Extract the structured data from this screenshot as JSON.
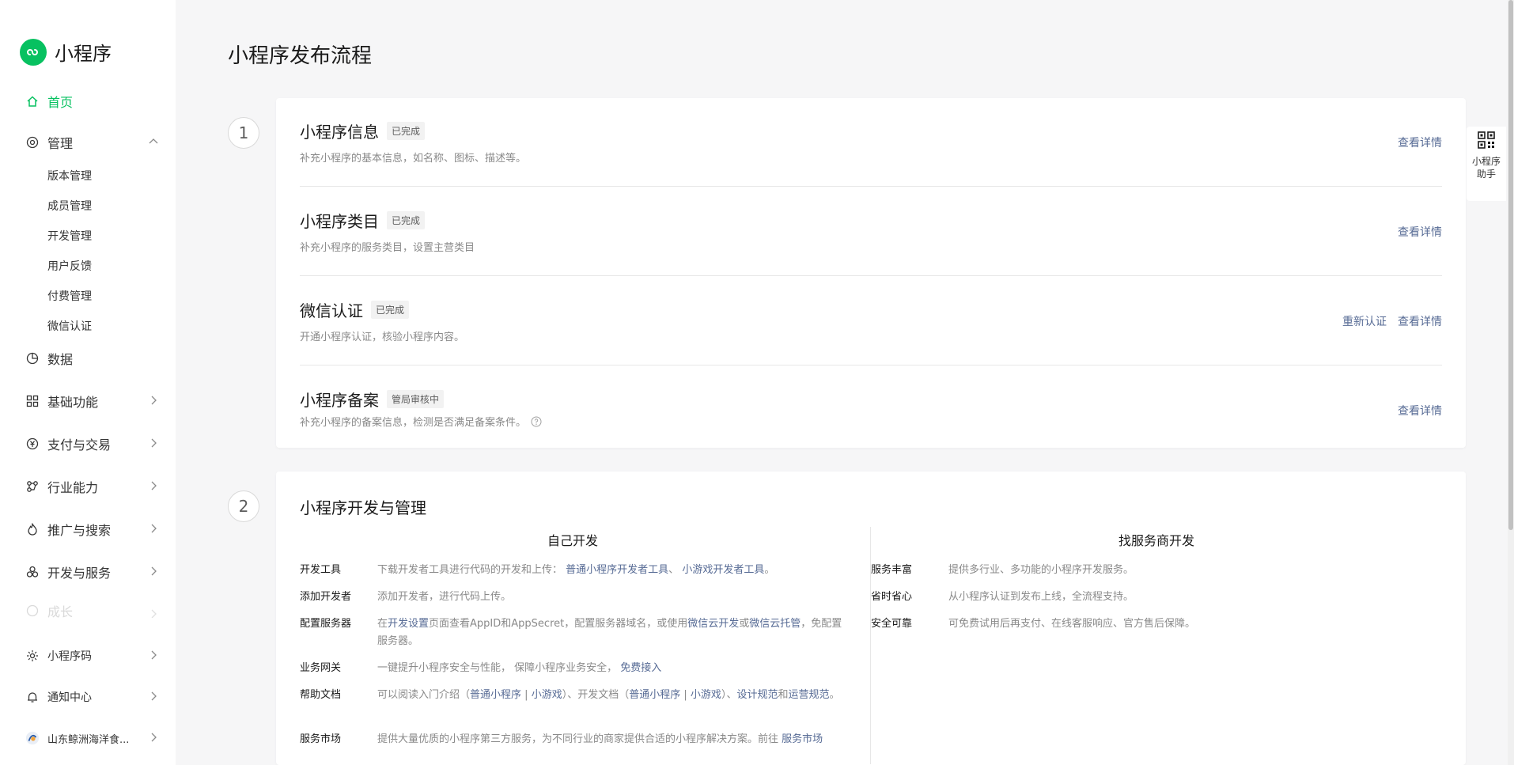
{
  "brand": {
    "name": "小程序"
  },
  "nav": {
    "home": "首页",
    "manage": "管理",
    "manage_sub": [
      "版本管理",
      "成员管理",
      "开发管理",
      "用户反馈",
      "付费管理",
      "微信认证"
    ],
    "data": "数据",
    "basic": "基础功能",
    "pay": "支付与交易",
    "industry": "行业能力",
    "promote": "推广与搜索",
    "devservice": "开发与服务",
    "growth": "成长",
    "qrcode": "小程序码",
    "notice": "通知中心",
    "account": "山东鲸洲海洋食..."
  },
  "page_title": "小程序发布流程",
  "steps": [
    "1",
    "2"
  ],
  "step1_rows": [
    {
      "title": "小程序信息",
      "badge": "已完成",
      "desc": "补充小程序的基本信息，如名称、图标、描述等。",
      "actions": [
        "查看详情"
      ]
    },
    {
      "title": "小程序类目",
      "badge": "已完成",
      "desc": "补充小程序的服务类目，设置主营类目",
      "actions": [
        "查看详情"
      ]
    },
    {
      "title": "微信认证",
      "badge": "已完成",
      "desc": "开通小程序认证，核验小程序内容。",
      "actions": [
        "重新认证",
        "查看详情"
      ]
    },
    {
      "title": "小程序备案",
      "badge": "管局审核中",
      "desc": "补充小程序的备案信息，检测是否满足备案条件。",
      "actions": [
        "查看详情"
      ]
    }
  ],
  "step2": {
    "title": "小程序开发与管理",
    "left_head": "自己开发",
    "right_head": "找服务商开发",
    "dev_tools": {
      "k": "开发工具",
      "pre": "下载开发者工具进行代码的开发和上传：",
      "l1": "普通小程序开发者工具",
      "sep": "、",
      "l2": "小游戏开发者工具",
      "end": "。"
    },
    "add_dev": {
      "k": "添加开发者",
      "v": "添加开发者，进行代码上传。"
    },
    "server": {
      "k": "配置服务器",
      "p1": "在",
      "l1": "开发设置",
      "p2": "页面查看AppID和AppSecret，配置服务器域名，或使用",
      "l2": "微信云开发",
      "p3": "或",
      "l3": "微信云托管",
      "p4": "，免配置服务器。"
    },
    "gateway": {
      "k": "业务网关",
      "v": "一键提升小程序安全与性能， 保障小程序业务安全，",
      "l": "免费接入"
    },
    "docs": {
      "k": "帮助文档",
      "p1": "可以阅读入门介绍（",
      "l1": "普通小程序",
      "bar1": "|",
      "l2": "小游戏",
      "p2": "）、开发文档（",
      "l3": "普通小程序",
      "bar2": "|",
      "l4": "小游戏",
      "p3": "）、",
      "l5": "设计规范",
      "p4": "和",
      "l6": "运营规范",
      "p5": "。"
    },
    "market": {
      "k": "服务市场",
      "v": "提供大量优质的小程序第三方服务，为不同行业的商家提供合适的小程序解决方案。前往",
      "l": "服务市场"
    },
    "right_rows": [
      {
        "k": "服务丰富",
        "v": "提供多行业、多功能的小程序开发服务。"
      },
      {
        "k": "省时省心",
        "v": "从小程序认证到发布上线，全流程支持。"
      },
      {
        "k": "安全可靠",
        "v": "可免费试用后再支付、在线客服响应、官方售后保障。"
      }
    ]
  },
  "helper": {
    "label": "小程序助手"
  },
  "colors": {
    "accent": "#07c160",
    "link": "#576b95"
  }
}
